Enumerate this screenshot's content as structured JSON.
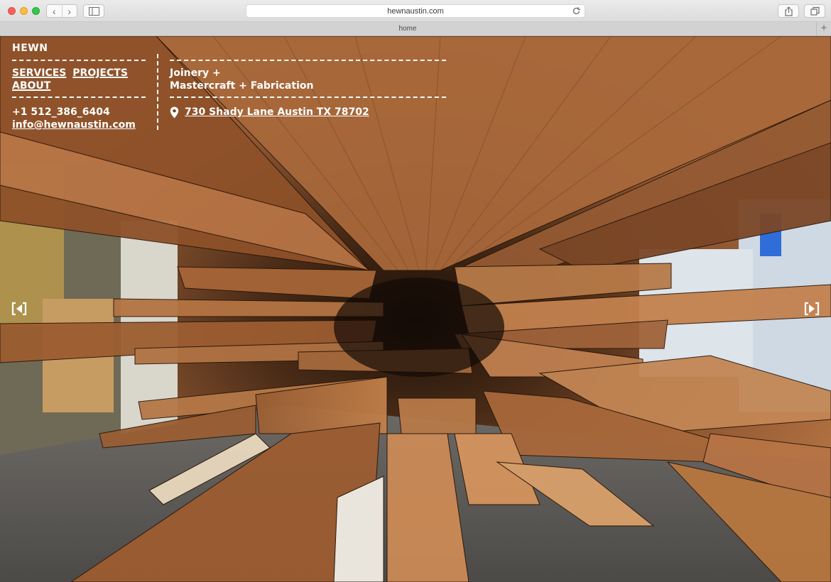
{
  "browser": {
    "url": "hewnaustin.com",
    "tab_title": "home",
    "new_tab_label": "+"
  },
  "nav": {
    "back": "‹",
    "forward": "›"
  },
  "site": {
    "brand": "HEWN",
    "menu": [
      "SERVICES",
      "PROJECTS",
      "ABOUT"
    ],
    "phone": "+1 512_386_6404",
    "email": "info@hewnaustin.com",
    "tagline_line1": "Joinery +",
    "tagline_line2": "Mastercraft + Fabrication",
    "address": "730 Shady Lane Austin TX 78702"
  },
  "colors": {
    "overlay_text": "#ffffff",
    "wood_dark": "#3b2618",
    "wood_mid": "#8a5430",
    "wood_light": "#c98a55"
  },
  "icons": {
    "location": "map-pin-icon",
    "prev": "slider-prev-icon",
    "next": "slider-next-icon"
  }
}
